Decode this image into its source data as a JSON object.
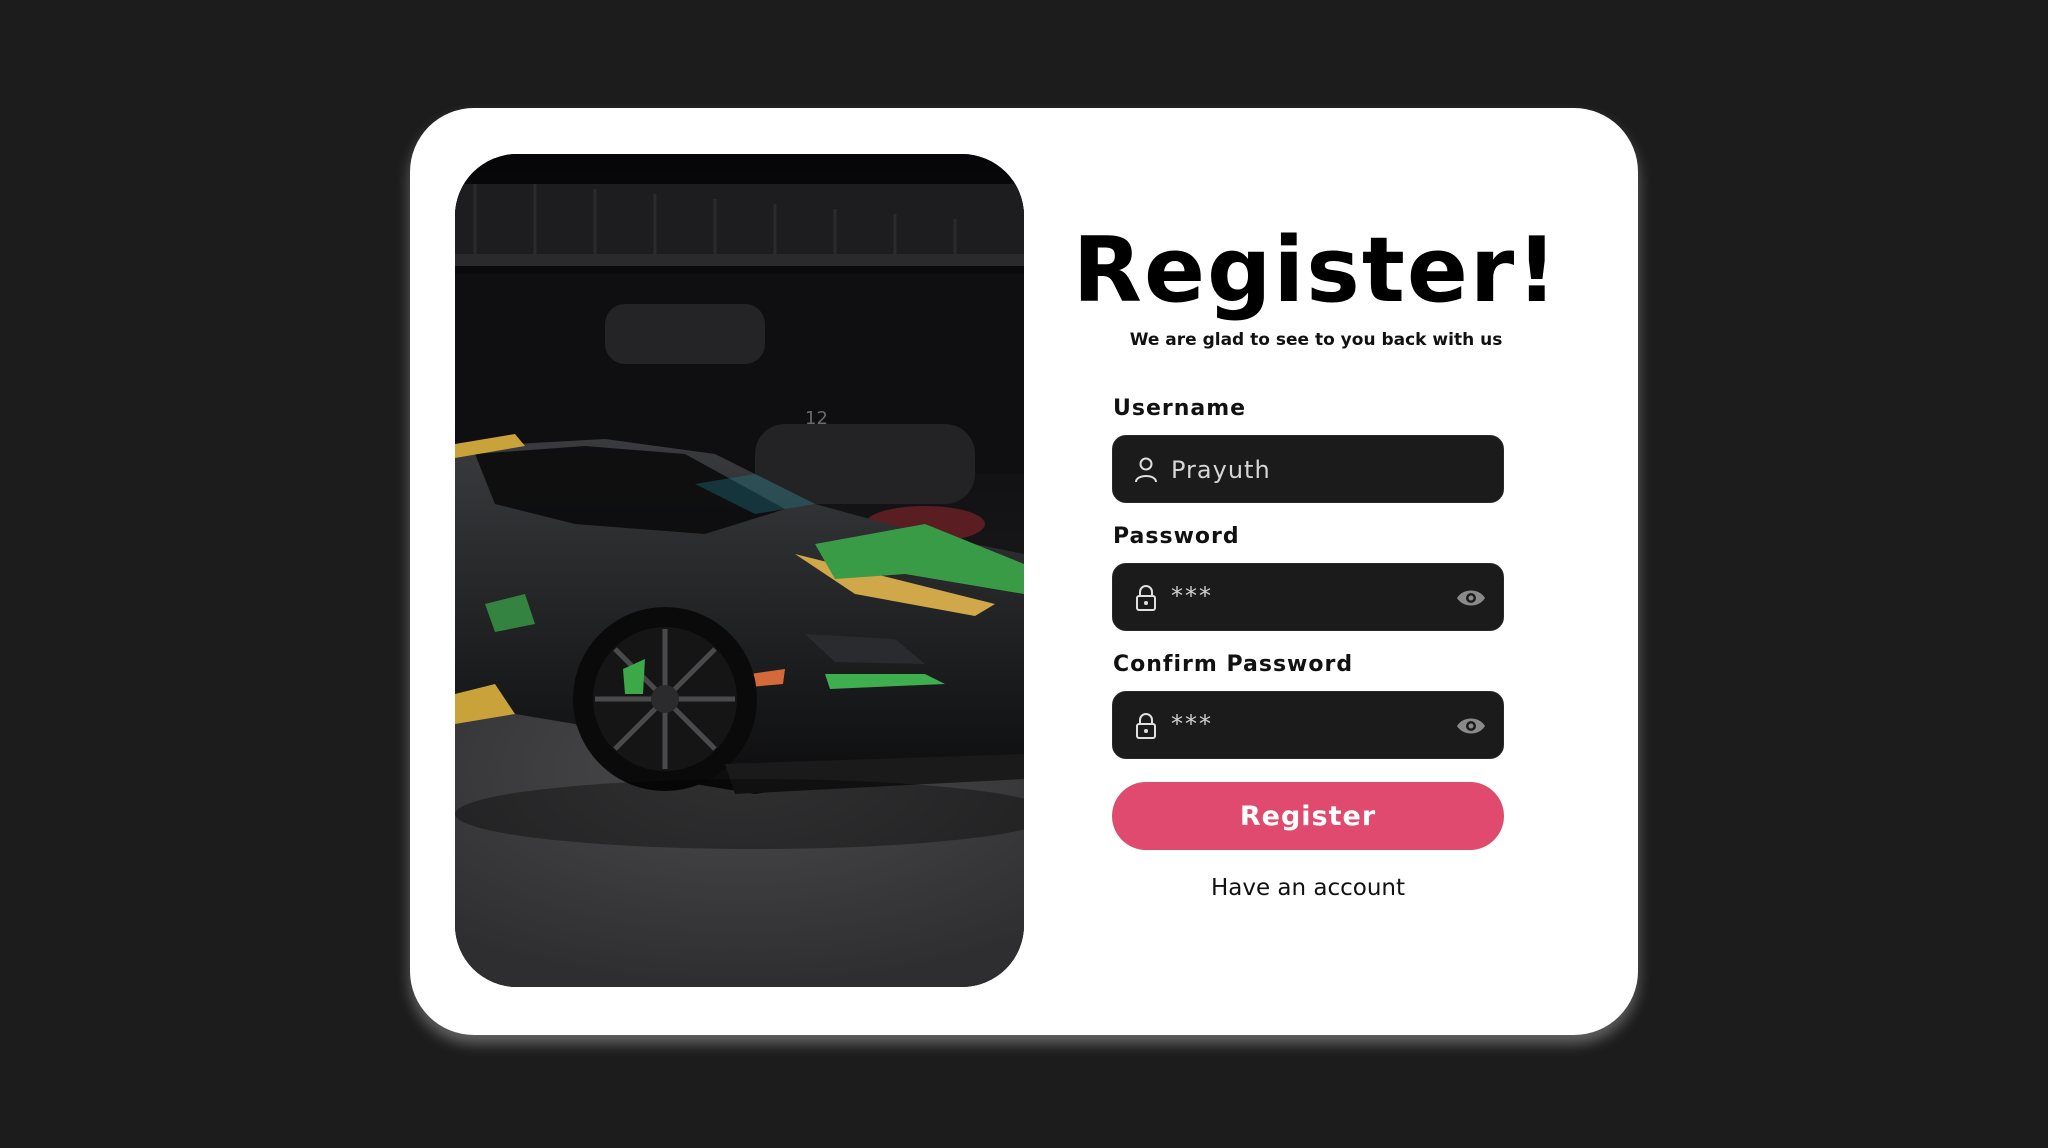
{
  "colors": {
    "page_background": "#1c1c1c",
    "card_background": "#ffffff",
    "field_background": "#1b1b1b",
    "accent": "#df4a6e"
  },
  "form": {
    "title": "Register!",
    "subtitle": "We are glad to see to you back with us",
    "username": {
      "label": "Username",
      "value": "Prayuth",
      "icon": "user-icon"
    },
    "password": {
      "label": "Password",
      "value": "***",
      "icon": "lock-icon",
      "toggle_icon": "eye-icon"
    },
    "confirm_password": {
      "label": "Confirm Password",
      "value": "***",
      "icon": "lock-icon",
      "toggle_icon": "eye-icon"
    },
    "submit_label": "Register",
    "login_link": "Have an account"
  },
  "image": {
    "plate_number": "12"
  }
}
